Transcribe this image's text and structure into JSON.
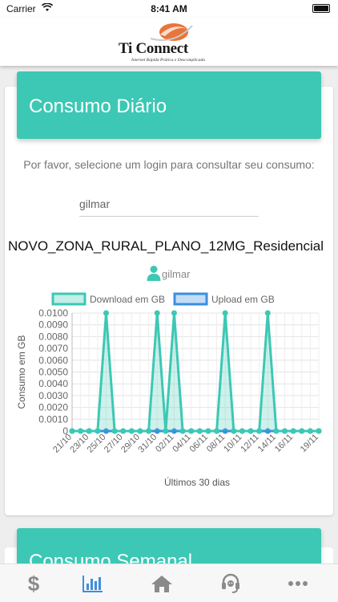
{
  "status_bar": {
    "carrier": "Carrier",
    "time": "8:41 AM"
  },
  "header": {
    "brand": "Ti Connect",
    "tagline": "Internet Rápida Prática e Descomplicada"
  },
  "daily": {
    "title": "Consumo Diário",
    "hint": "Por favor, selecione um login para consultar seu consumo:",
    "login_value": "gilmar",
    "plan": "NOVO_ZONA_RURAL_PLANO_12MG_Residencial",
    "user": "gilmar"
  },
  "weekly": {
    "title": "Consumo Semanal"
  },
  "colors": {
    "accent": "#3cc8b4",
    "download": "#3cc8b4",
    "upload": "#3a8fe0",
    "tab_active": "#3a8fe0",
    "tab_inactive": "#8a8a8a"
  },
  "tabs": [
    {
      "name": "dollar-icon",
      "active": false
    },
    {
      "name": "bar-chart-icon",
      "active": true
    },
    {
      "name": "home-icon",
      "active": false
    },
    {
      "name": "support-headset-icon",
      "active": false
    },
    {
      "name": "more-icon",
      "active": false
    }
  ],
  "chart_data": {
    "type": "line",
    "ylabel": "Consumo em GB",
    "xlabel": "Últimos 30 dias",
    "ylim": [
      0,
      0.01
    ],
    "y_ticks": [
      "0",
      "0.0010",
      "0.0020",
      "0.0030",
      "0.0040",
      "0.0050",
      "0.0060",
      "0.0070",
      "0.0080",
      "0.0090",
      "0.0100"
    ],
    "x": [
      "21/10",
      "22/10",
      "23/10",
      "24/10",
      "25/10",
      "26/10",
      "27/10",
      "28/10",
      "29/10",
      "30/10",
      "31/10",
      "01/11",
      "02/11",
      "03/11",
      "04/11",
      "05/11",
      "06/11",
      "07/11",
      "08/11",
      "09/11",
      "10/11",
      "11/11",
      "12/11",
      "13/11",
      "14/11",
      "15/11",
      "16/11",
      "17/11",
      "18/11",
      "19/11"
    ],
    "x_tick_labels": [
      "21/10",
      "23/10",
      "25/10",
      "27/10",
      "29/10",
      "31/10",
      "02/11",
      "04/11",
      "06/11",
      "08/11",
      "10/11",
      "12/11",
      "14/11",
      "16/11",
      "19/11"
    ],
    "series": [
      {
        "name": "Download em GB",
        "values": [
          0,
          0,
          0,
          0,
          0.01,
          0,
          0,
          0,
          0,
          0,
          0.01,
          0,
          0.01,
          0,
          0,
          0,
          0,
          0,
          0.01,
          0,
          0,
          0,
          0,
          0.01,
          0,
          0,
          0,
          0,
          0,
          0
        ]
      },
      {
        "name": "Upload em GB",
        "values": [
          0,
          0,
          0,
          0,
          0,
          0,
          0,
          0,
          0,
          0,
          0,
          0,
          0,
          0,
          0,
          0,
          0,
          0,
          0,
          0,
          0,
          0,
          0,
          0,
          0,
          0,
          0,
          0,
          0,
          0
        ]
      }
    ],
    "grid": true,
    "legend": "top"
  }
}
